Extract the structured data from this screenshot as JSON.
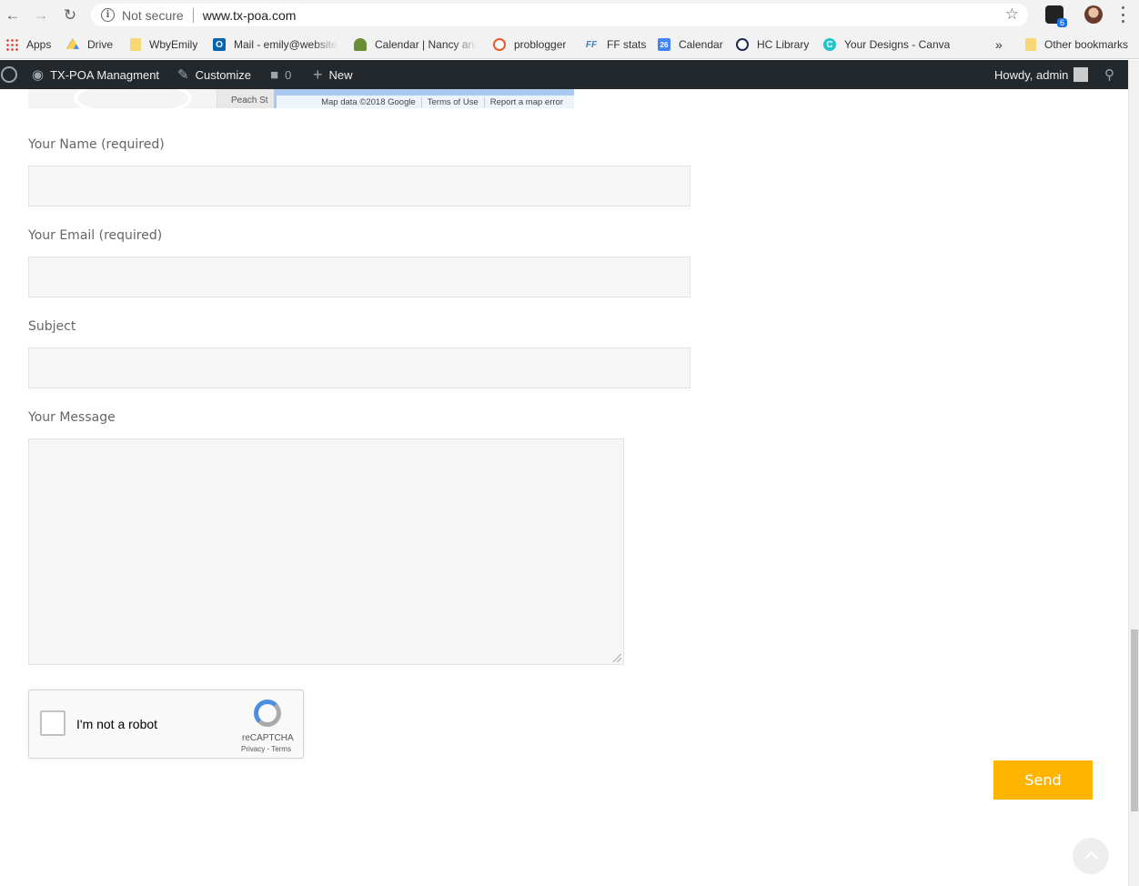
{
  "browser": {
    "security_label": "Not secure",
    "url": "www.tx-poa.com",
    "extension_badge": "6"
  },
  "bookmarks": [
    {
      "label": "Apps",
      "icon": "apps-grid-icon"
    },
    {
      "label": "Drive",
      "icon": "drive-icon"
    },
    {
      "label": "WbyEmily",
      "icon": "folder-icon"
    },
    {
      "label": "Mail - emily@website",
      "icon": "outlook-icon"
    },
    {
      "label": "Calendar | Nancy and",
      "icon": "plant-icon"
    },
    {
      "label": "problogger",
      "icon": "problogger-icon"
    },
    {
      "label": "FF stats",
      "icon": "ff-icon"
    },
    {
      "label": "Calendar",
      "icon": "calendar-icon",
      "icon_text": "26"
    },
    {
      "label": "HC Library",
      "icon": "library-icon"
    },
    {
      "label": "Your Designs - Canva",
      "icon": "canva-icon",
      "icon_text": "C"
    }
  ],
  "bookmarks_overflow": "»",
  "other_bookmarks": "Other bookmarks",
  "admin_bar": {
    "site_name": "TX-POA Managment",
    "customize": "Customize",
    "comments_count": "0",
    "new": "New",
    "greeting": "Howdy, admin"
  },
  "map": {
    "street": "Peach St",
    "attribution": [
      "Map data ©2018 Google",
      "Terms of Use",
      "Report a map error"
    ]
  },
  "form": {
    "name_label": "Your Name (required)",
    "email_label": "Your Email (required)",
    "subject_label": "Subject",
    "message_label": "Your Message",
    "send_label": "Send"
  },
  "recaptcha": {
    "label": "I'm not a robot",
    "brand": "reCAPTCHA",
    "terms": "Privacy - Terms"
  },
  "colors": {
    "send_button": "#ffb400",
    "admin_bar": "#23282d"
  }
}
